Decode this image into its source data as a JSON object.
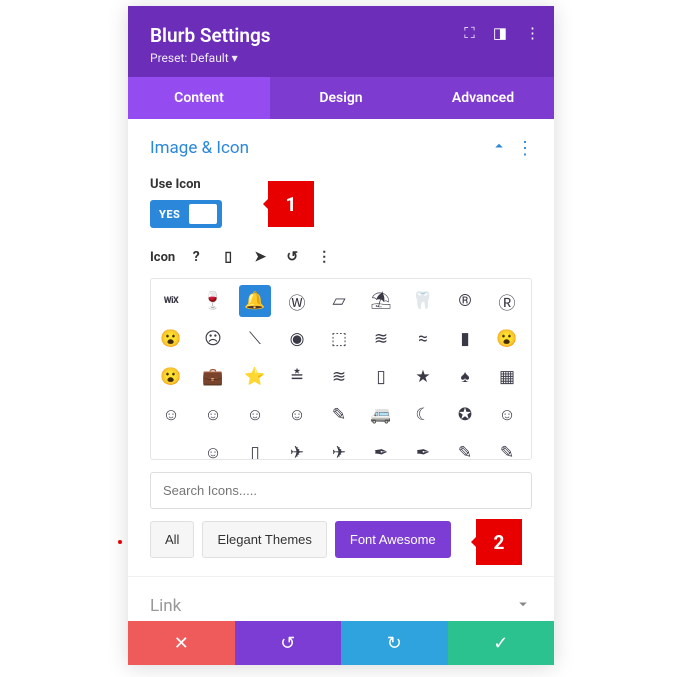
{
  "header": {
    "title": "Blurb Settings",
    "preset": "Preset: Default ▾"
  },
  "tabs": {
    "content": "Content",
    "design": "Design",
    "advanced": "Advanced"
  },
  "section_image_icon": {
    "title": "Image & Icon",
    "use_icon_label": "Use Icon",
    "toggle_text": "YES",
    "icon_label": "Icon"
  },
  "icon_grid": [
    "WiX",
    "🍷",
    "🔔",
    "Ⓦ",
    "▱",
    "⛱",
    "🦷",
    "®",
    "Ⓡ",
    "😮",
    "☹",
    "⟍",
    "◉",
    "⬚",
    "≋",
    "≈",
    "▮",
    "😮",
    "😮",
    "💼",
    "⭐",
    "≛",
    "≋",
    "▯",
    "★",
    "♠",
    "▦",
    "☺",
    "☺",
    "☺",
    "☺",
    "✎",
    "🚐",
    "☾",
    "✪",
    "☺",
    "",
    "☺",
    "▯",
    "✈",
    "✈",
    "✒",
    "✒",
    "✎",
    "✎"
  ],
  "search": {
    "placeholder": "Search Icons....."
  },
  "filters": {
    "all": "All",
    "elegant_themes": "Elegant Themes",
    "font_awesome": "Font Awesome"
  },
  "link_section_title": "Link",
  "callouts": {
    "c1": "1",
    "c2": "2"
  }
}
